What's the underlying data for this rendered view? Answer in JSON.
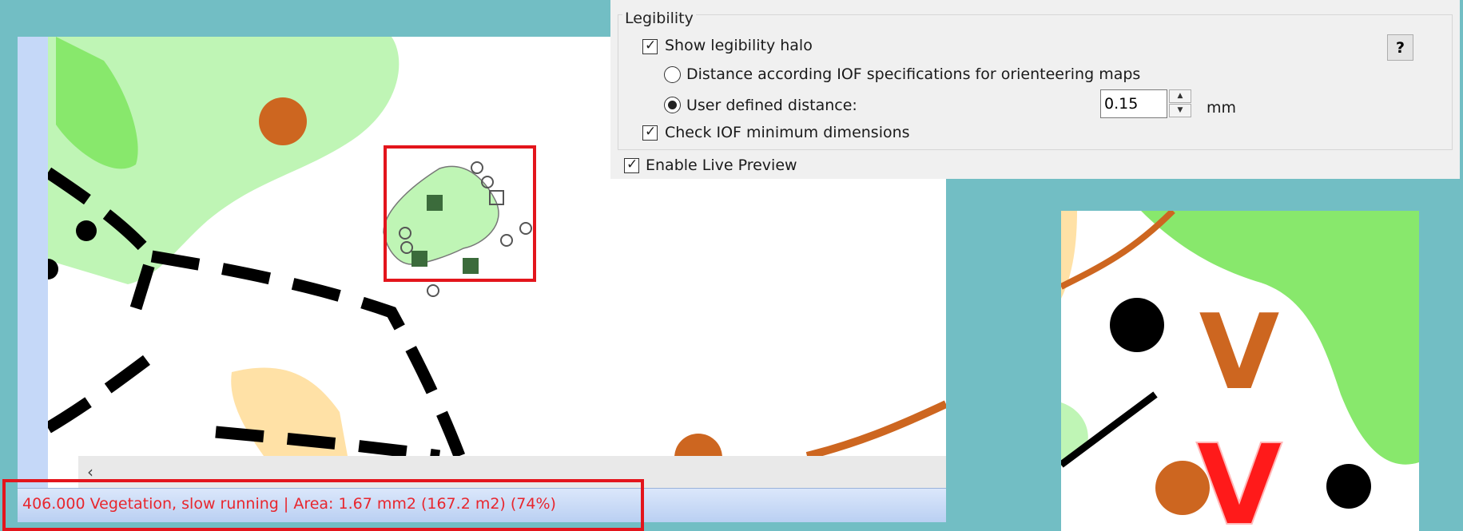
{
  "legibility": {
    "title": "Legibility",
    "show_halo_label": "Show legibility halo",
    "show_halo_checked": true,
    "iof_distance_label": "Distance according IOF specifications for orienteering maps",
    "user_distance_label": "User defined distance:",
    "selected_distance_mode": "user_defined",
    "distance_value": "0.15",
    "distance_unit": "mm",
    "check_min_dimensions_label": "Check IOF minimum dimensions",
    "check_min_dimensions_checked": true
  },
  "help_button_label": "?",
  "live_preview": {
    "label": "Enable Live Preview",
    "checked": true
  },
  "status_bar": {
    "text": "406.000 Vegetation, slow running  |  Area: 1.67 mm2 (167.2 m2)  (74%)"
  },
  "preview": {
    "symbol_letter": "V"
  },
  "colors": {
    "background": "#72bec4",
    "vegetation_light": "#bff5b5",
    "vegetation_dark": "#88e86c",
    "brown": "#cd6620",
    "yellow": "#ffe1a6",
    "highlight_red": "#e3151c",
    "status_text": "#e8262e"
  },
  "icons": {
    "scroll_left": "chevron-left-icon",
    "help": "question-icon"
  }
}
